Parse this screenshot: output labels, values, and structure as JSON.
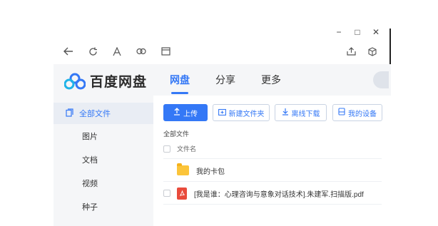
{
  "window": {
    "controls": {
      "minimize": "−",
      "maximize": "□",
      "close": "✕"
    }
  },
  "toolbar": {
    "icons": [
      "back-arrow-icon",
      "refresh-icon",
      "font-icon",
      "link-icon",
      "panel-icon"
    ],
    "right_icons": [
      "share-icon",
      "cube-icon"
    ]
  },
  "app": {
    "logo_text": "百度网盘"
  },
  "nav": {
    "tabs": [
      {
        "label": "网盘"
      },
      {
        "label": "分享"
      },
      {
        "label": "更多"
      }
    ]
  },
  "sidebar": {
    "items": [
      {
        "label": "全部文件",
        "icon": "files-icon"
      },
      {
        "label": "图片"
      },
      {
        "label": "文档"
      },
      {
        "label": "视频"
      },
      {
        "label": "种子"
      }
    ]
  },
  "actions": {
    "upload": "上传",
    "new_folder": "新建文件夹",
    "offline_download": "离线下载",
    "my_devices": "我的设备"
  },
  "breadcrumb": "全部文件",
  "table": {
    "column_filename": "文件名",
    "rows": [
      {
        "name": "我的卡包",
        "type": "folder"
      },
      {
        "name": "[我是谁：心理咨询与意象对话技术].朱建军.扫描版.pdf",
        "type": "pdf"
      }
    ]
  },
  "colors": {
    "accent": "#3478f6",
    "sidebar_bg": "#f5f6f8",
    "folder": "#fbc43a",
    "pdf": "#e94b3c"
  }
}
